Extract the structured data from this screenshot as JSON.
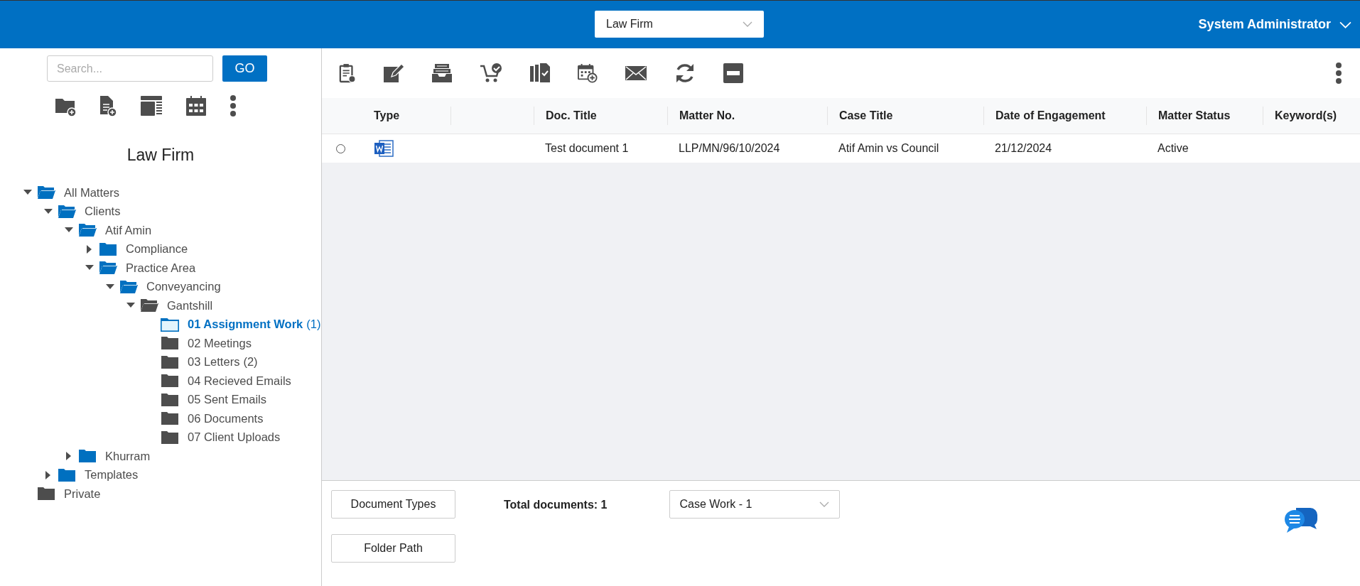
{
  "header": {
    "firm_select": "Law Firm",
    "user": "System Administrator"
  },
  "sidebar": {
    "search": {
      "placeholder": "Search..."
    },
    "go_button": "GO",
    "title": "Law Firm",
    "tree": [
      {
        "label": "All Matters",
        "expanded": true,
        "selected": false,
        "color": "#0070c0",
        "children": [
          {
            "label": "Clients",
            "expanded": true,
            "selected": false,
            "color": "#0070c0",
            "children": [
              {
                "label": "Atif Amin",
                "expanded": true,
                "selected": false,
                "color": "#0070c0",
                "children": [
                  {
                    "label": "Compliance",
                    "expanded": false,
                    "selected": false,
                    "color": "#0070c0"
                  },
                  {
                    "label": "Practice Area",
                    "expanded": true,
                    "selected": false,
                    "color": "#0070c0",
                    "children": [
                      {
                        "label": "Conveyancing",
                        "expanded": true,
                        "selected": false,
                        "color": "#0070c0",
                        "children": [
                          {
                            "label": "Gantshill",
                            "expanded": true,
                            "selected": false,
                            "color": "#4d4d4d",
                            "children": [
                              {
                                "label": "01 Assignment Work",
                                "count": "(1)",
                                "selected": true,
                                "color": "#0070c0"
                              },
                              {
                                "label": "02 Meetings",
                                "selected": false,
                                "color": "#4d4d4d"
                              },
                              {
                                "label": "03 Letters",
                                "count": "(2)",
                                "selected": false,
                                "color": "#4d4d4d"
                              },
                              {
                                "label": "04 Recieved Emails",
                                "selected": false,
                                "color": "#4d4d4d"
                              },
                              {
                                "label": "05 Sent Emails",
                                "selected": false,
                                "color": "#4d4d4d"
                              },
                              {
                                "label": "06 Documents",
                                "selected": false,
                                "color": "#4d4d4d"
                              },
                              {
                                "label": "07 Client Uploads",
                                "selected": false,
                                "color": "#4d4d4d"
                              }
                            ]
                          }
                        ]
                      }
                    ]
                  }
                ]
              },
              {
                "label": "Khurram",
                "expanded": false,
                "selected": false,
                "color": "#0070c0"
              }
            ]
          },
          {
            "label": "Templates",
            "expanded": false,
            "selected": false,
            "color": "#0070c0"
          }
        ]
      },
      {
        "label": "Private",
        "selected": false,
        "color": "#4d4d4d"
      }
    ]
  },
  "table": {
    "columns": [
      "Type",
      "",
      "Doc. Title",
      "Matter No.",
      "Case Title",
      "Date of Engagement",
      "Matter Status",
      "Keyword(s)"
    ],
    "rows": [
      {
        "selected": false,
        "kind": "word",
        "cells": [
          "",
          "",
          "Test document 1",
          "LLP/MN/96/10/2024",
          "Atif Amin vs Council",
          "21/12/2024",
          "Active"
        ]
      }
    ]
  },
  "footer": {
    "buttons": [
      "Document Types",
      "Folder Path"
    ],
    "total": "Total documents: 1",
    "view_select": "Case Work - 1"
  }
}
